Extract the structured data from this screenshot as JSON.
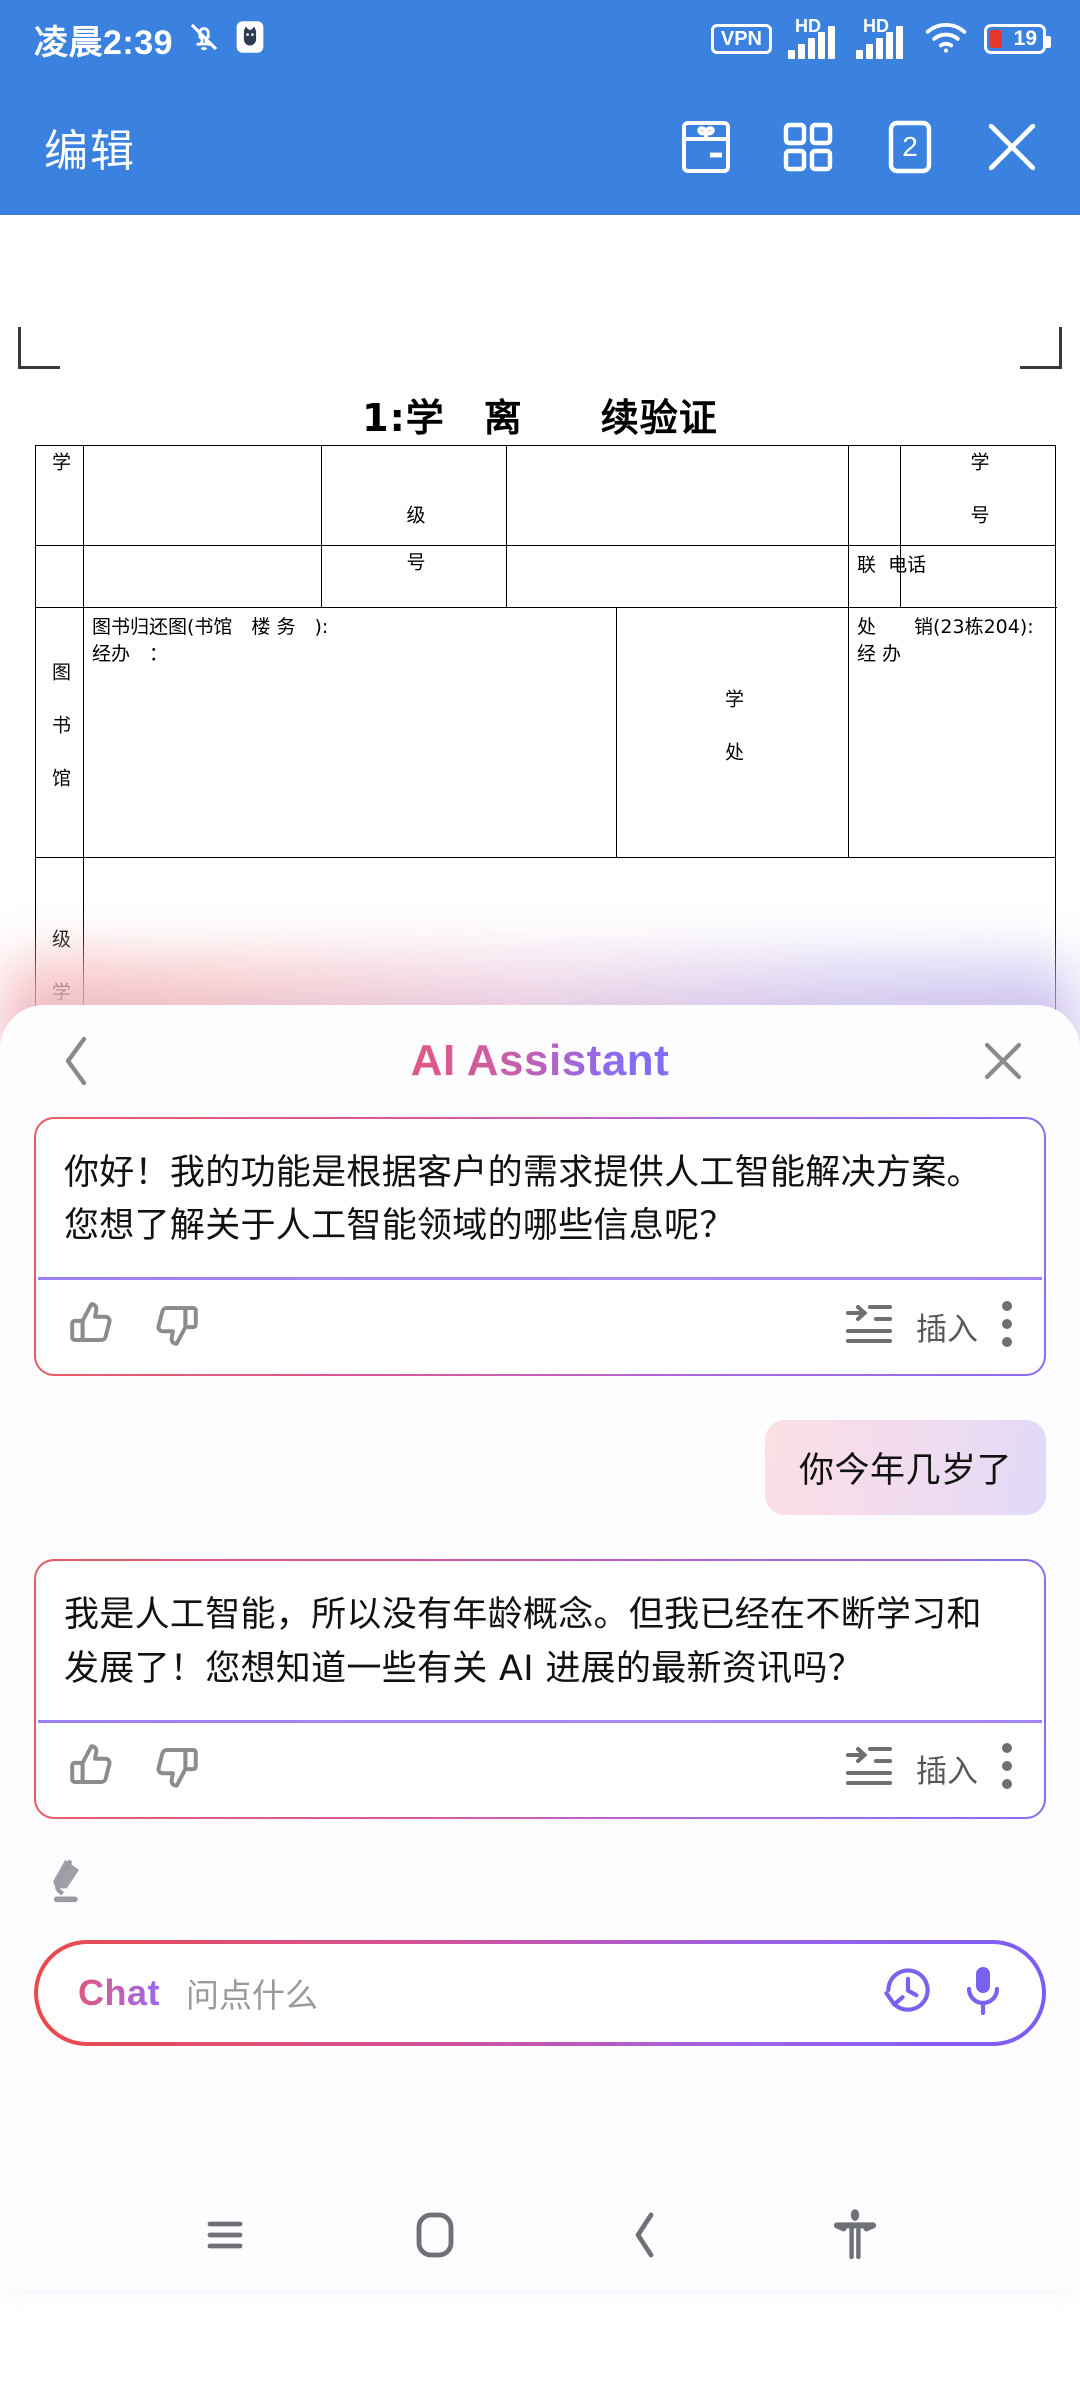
{
  "status_bar": {
    "time": "凌晨2:39",
    "mute_icon": "bell-muted-icon",
    "app_icon": "cat-badge-icon",
    "vpn_label": "VPN",
    "network_label_1": "HD",
    "network_label_2": "HD",
    "wifi_icon": "wifi-icon",
    "battery_percent": "19",
    "bg_color": "#3b82e0"
  },
  "app_bar": {
    "title": "编辑",
    "actions": [
      {
        "name": "gift-box-icon",
        "label": ""
      },
      {
        "name": "grid-apps-icon",
        "label": ""
      },
      {
        "name": "tab-count-icon",
        "label": "2"
      },
      {
        "name": "close-icon",
        "label": ""
      }
    ]
  },
  "document": {
    "title": "1:学　离　　续验证",
    "table": {
      "row1": {
        "c1": "学",
        "c2": "",
        "c3": "级",
        "c4": "",
        "c5": "",
        "c6": "学\n号",
        "c7": ""
      },
      "row2": {
        "c1": "",
        "c2": "",
        "c3": "号",
        "c4": "",
        "c5": "联  电话",
        "c6": ""
      },
      "row3": {
        "label_left": "图\n书\n馆",
        "text_left_line1": "图书归还图(书馆　楼 务　):",
        "text_left_line2": "经办　：",
        "label_mid": "学\n\n处",
        "text_right_line1": "处　　销(23栋204):",
        "text_right_line2": "经 办"
      },
      "row4": {
        "label_left": "级\n学",
        "body": ""
      }
    }
  },
  "ai_panel": {
    "header": {
      "back_icon": "chevron-left-icon",
      "title": "AI Assistant",
      "close_icon": "close-icon"
    },
    "messages": [
      {
        "role": "assistant",
        "text": "你好！我的功能是根据客户的需求提供人工智能解决方案。您想了解关于人工智能领域的哪些信息呢？",
        "actions": {
          "thumbs_up_icon": "thumbs-up-icon",
          "thumbs_down_icon": "thumbs-down-icon",
          "insert_icon": "insert-text-icon",
          "insert_label": "插入",
          "more_icon": "more-vertical-icon"
        }
      },
      {
        "role": "user",
        "text": "你今年几岁了"
      },
      {
        "role": "assistant",
        "text": "我是人工智能，所以没有年龄概念。但我已经在不断学习和发展了！您想知道一些有关 AI 进展的最新资讯吗？",
        "actions": {
          "thumbs_up_icon": "thumbs-up-icon",
          "thumbs_down_icon": "thumbs-down-icon",
          "insert_icon": "insert-text-icon",
          "insert_label": "插入",
          "more_icon": "more-vertical-icon"
        }
      }
    ],
    "clear_icon": "eraser-icon",
    "input": {
      "label": "Chat",
      "placeholder": "问点什么",
      "value": "",
      "history_icon": "history-icon",
      "mic_icon": "microphone-icon"
    }
  },
  "nav_bar": {
    "items": [
      {
        "name": "recents-menu-icon"
      },
      {
        "name": "home-icon"
      },
      {
        "name": "back-icon"
      },
      {
        "name": "accessibility-icon"
      }
    ]
  },
  "colors": {
    "app_bar_bg": "#3b82e0",
    "accent_pink": "#e1587f",
    "accent_purple": "#8b6cf2",
    "battery_red": "#e8362d"
  }
}
